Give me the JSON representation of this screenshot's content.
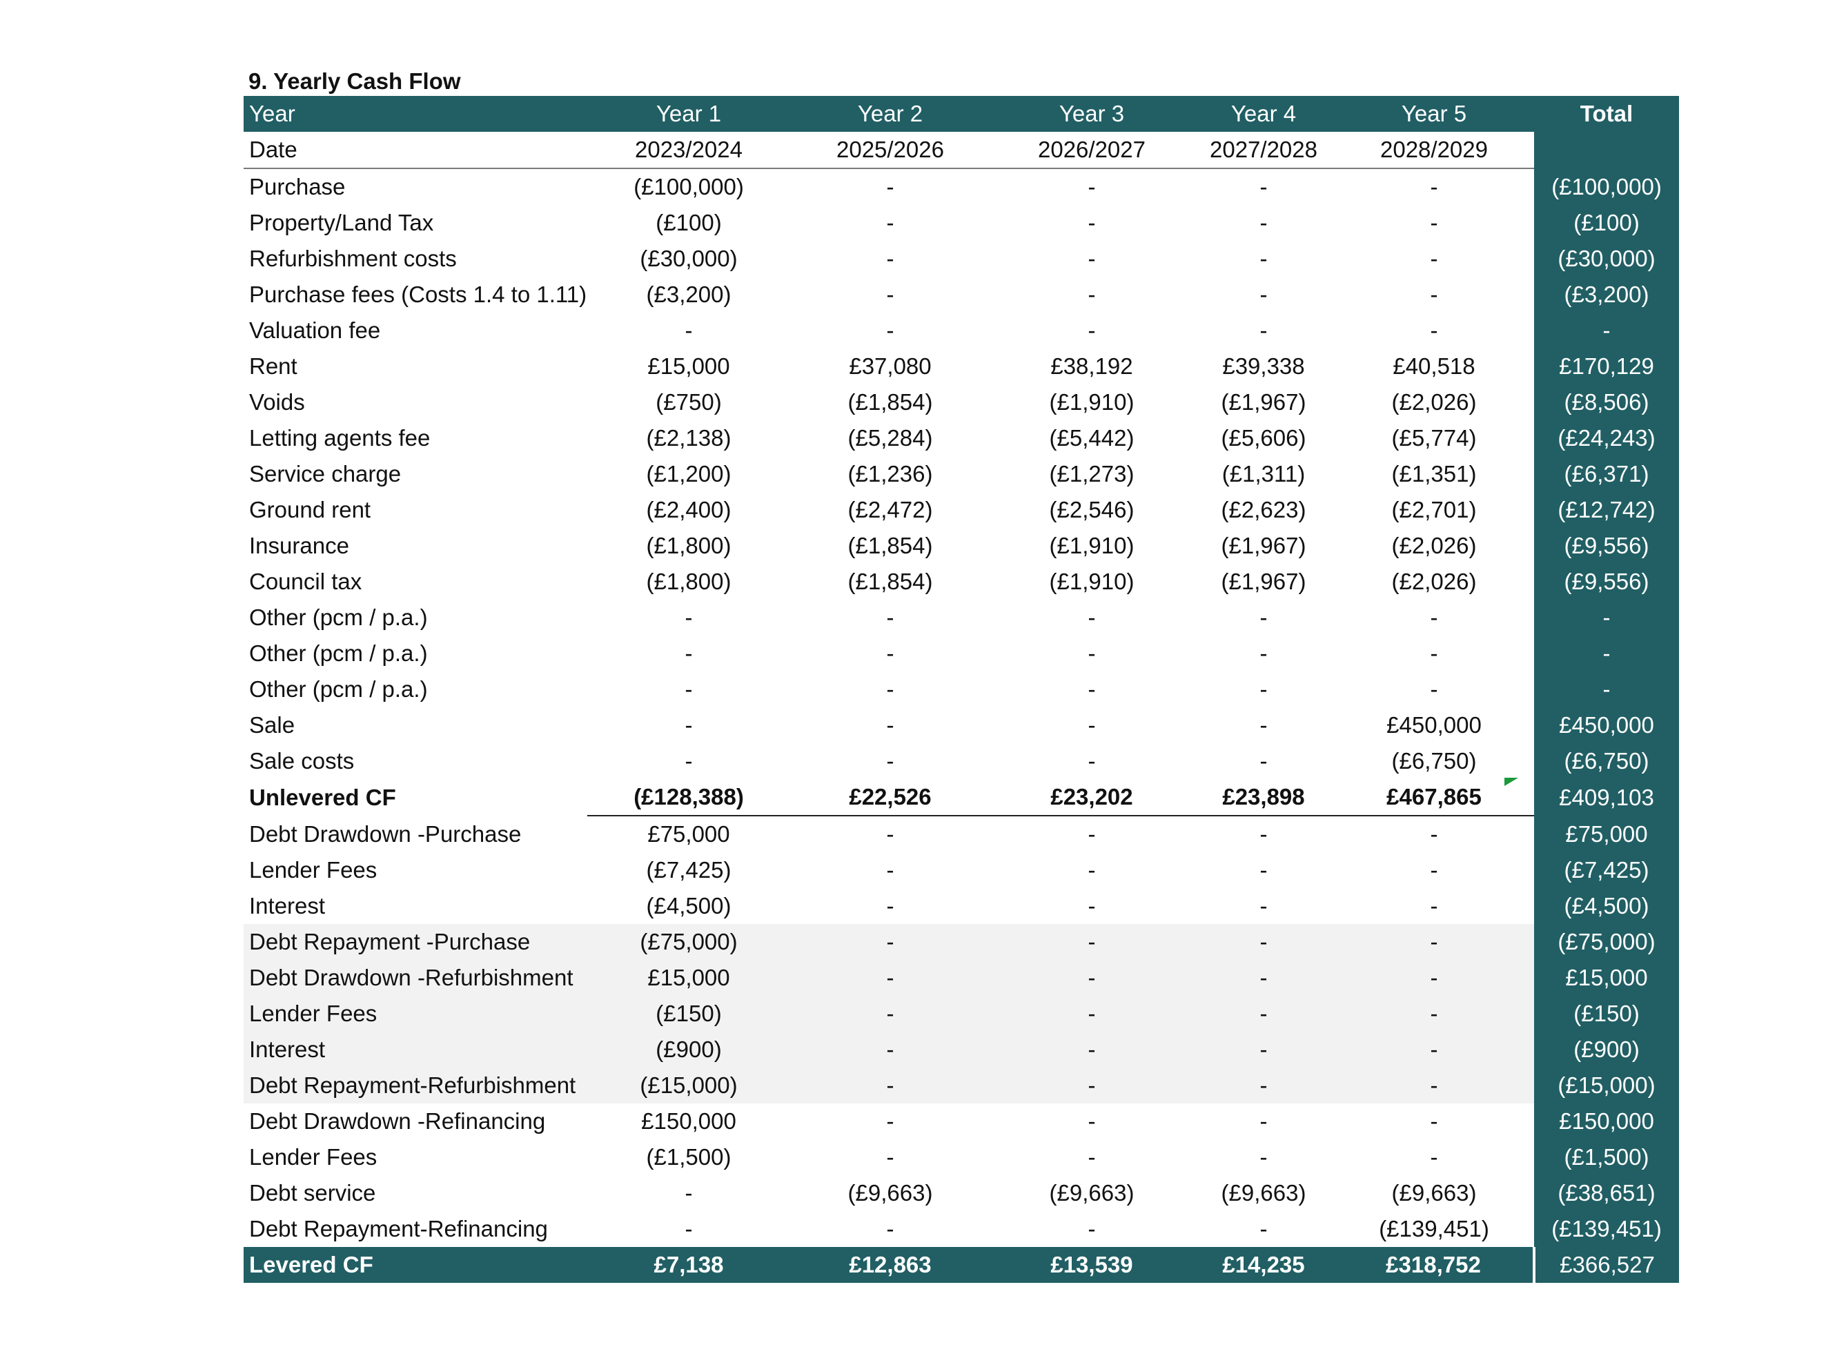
{
  "title": "9. Yearly Cash Flow",
  "header": {
    "label": "Year",
    "years": [
      "Year 1",
      "Year 2",
      "Year 3",
      "Year 4",
      "Year 5"
    ],
    "total": "Total"
  },
  "date_row": {
    "label": "Date",
    "values": [
      "2023/2024",
      "2025/2026",
      "2026/2027",
      "2027/2028",
      "2028/2029"
    ],
    "total": ""
  },
  "rows": [
    {
      "label": "Purchase",
      "values": [
        "(£100,000)",
        "-",
        "-",
        "-",
        "-"
      ],
      "total": "(£100,000)",
      "style": ""
    },
    {
      "label": "Property/Land Tax",
      "values": [
        "(£100)",
        "-",
        "-",
        "-",
        "-"
      ],
      "total": "(£100)",
      "style": ""
    },
    {
      "label": "Refurbishment costs",
      "values": [
        "(£30,000)",
        "-",
        "-",
        "-",
        "-"
      ],
      "total": "(£30,000)",
      "style": ""
    },
    {
      "label": "Purchase fees (Costs 1.4 to 1.11)",
      "values": [
        "(£3,200)",
        "-",
        "-",
        "-",
        "-"
      ],
      "total": "(£3,200)",
      "style": ""
    },
    {
      "label": "Valuation fee",
      "values": [
        "-",
        "-",
        "-",
        "-",
        "-"
      ],
      "total": "-",
      "style": ""
    },
    {
      "label": "Rent",
      "values": [
        "£15,000",
        "£37,080",
        "£38,192",
        "£39,338",
        "£40,518"
      ],
      "total": "£170,129",
      "style": ""
    },
    {
      "label": "Voids",
      "values": [
        "(£750)",
        "(£1,854)",
        "(£1,910)",
        "(£1,967)",
        "(£2,026)"
      ],
      "total": "(£8,506)",
      "style": ""
    },
    {
      "label": "Letting agents fee",
      "values": [
        "(£2,138)",
        "(£5,284)",
        "(£5,442)",
        "(£5,606)",
        "(£5,774)"
      ],
      "total": "(£24,243)",
      "style": ""
    },
    {
      "label": "Service charge",
      "values": [
        "(£1,200)",
        "(£1,236)",
        "(£1,273)",
        "(£1,311)",
        "(£1,351)"
      ],
      "total": "(£6,371)",
      "style": ""
    },
    {
      "label": "Ground rent",
      "values": [
        "(£2,400)",
        "(£2,472)",
        "(£2,546)",
        "(£2,623)",
        "(£2,701)"
      ],
      "total": "(£12,742)",
      "style": ""
    },
    {
      "label": "Insurance",
      "values": [
        "(£1,800)",
        "(£1,854)",
        "(£1,910)",
        "(£1,967)",
        "(£2,026)"
      ],
      "total": "(£9,556)",
      "style": ""
    },
    {
      "label": "Council tax",
      "values": [
        "(£1,800)",
        "(£1,854)",
        "(£1,910)",
        "(£1,967)",
        "(£2,026)"
      ],
      "total": "(£9,556)",
      "style": ""
    },
    {
      "label": "Other (pcm / p.a.)",
      "values": [
        "-",
        "-",
        "-",
        "-",
        "-"
      ],
      "total": "-",
      "style": ""
    },
    {
      "label": "Other (pcm / p.a.)",
      "values": [
        "-",
        "-",
        "-",
        "-",
        "-"
      ],
      "total": "-",
      "style": ""
    },
    {
      "label": "Other (pcm / p.a.)",
      "values": [
        "-",
        "-",
        "-",
        "-",
        "-"
      ],
      "total": "-",
      "style": ""
    },
    {
      "label": "Sale",
      "values": [
        "-",
        "-",
        "-",
        "-",
        "£450,000"
      ],
      "total": "£450,000",
      "style": ""
    },
    {
      "label": "Sale costs",
      "values": [
        "-",
        "-",
        "-",
        "-",
        "(£6,750)"
      ],
      "total": "(£6,750)",
      "style": ""
    },
    {
      "label": "Unlevered CF",
      "values": [
        "(£128,388)",
        "£22,526",
        "£23,202",
        "£23,898",
        "£467,865"
      ],
      "total": "£409,103",
      "style": "bold bold-border"
    },
    {
      "label": "Debt Drawdown -Purchase",
      "values": [
        "£75,000",
        "-",
        "-",
        "-",
        "-"
      ],
      "total": "£75,000",
      "style": ""
    },
    {
      "label": "Lender Fees",
      "values": [
        "(£7,425)",
        "-",
        "-",
        "-",
        "-"
      ],
      "total": "(£7,425)",
      "style": ""
    },
    {
      "label": "Interest",
      "values": [
        "(£4,500)",
        "-",
        "-",
        "-",
        "-"
      ],
      "total": "(£4,500)",
      "style": ""
    },
    {
      "label": "Debt Repayment -Purchase",
      "values": [
        "(£75,000)",
        "-",
        "-",
        "-",
        "-"
      ],
      "total": "(£75,000)",
      "style": "shade"
    },
    {
      "label": "Debt Drawdown -Refurbishment",
      "values": [
        "£15,000",
        "-",
        "-",
        "-",
        "-"
      ],
      "total": "£15,000",
      "style": "shade"
    },
    {
      "label": "Lender Fees",
      "values": [
        "(£150)",
        "-",
        "-",
        "-",
        "-"
      ],
      "total": "(£150)",
      "style": "shade"
    },
    {
      "label": "Interest",
      "values": [
        "(£900)",
        "-",
        "-",
        "-",
        "-"
      ],
      "total": "(£900)",
      "style": "shade"
    },
    {
      "label": "Debt Repayment-Refurbishment",
      "values": [
        "(£15,000)",
        "-",
        "-",
        "-",
        "-"
      ],
      "total": "(£15,000)",
      "style": "shade"
    },
    {
      "label": "Debt Drawdown -Refinancing",
      "values": [
        "£150,000",
        "-",
        "-",
        "-",
        "-"
      ],
      "total": "£150,000",
      "style": ""
    },
    {
      "label": "Lender Fees",
      "values": [
        "(£1,500)",
        "-",
        "-",
        "-",
        "-"
      ],
      "total": "(£1,500)",
      "style": ""
    },
    {
      "label": "Debt service",
      "values": [
        "-",
        "(£9,663)",
        "(£9,663)",
        "(£9,663)",
        "(£9,663)"
      ],
      "total": "(£38,651)",
      "style": ""
    },
    {
      "label": "Debt Repayment-Refinancing",
      "values": [
        "-",
        "-",
        "-",
        "-",
        "(£139,451)"
      ],
      "total": "(£139,451)",
      "style": ""
    },
    {
      "label": "Levered CF",
      "values": [
        "£7,138",
        "£12,863",
        "£13,539",
        "£14,235",
        "£318,752"
      ],
      "total": "£366,527",
      "style": "levered"
    }
  ]
}
